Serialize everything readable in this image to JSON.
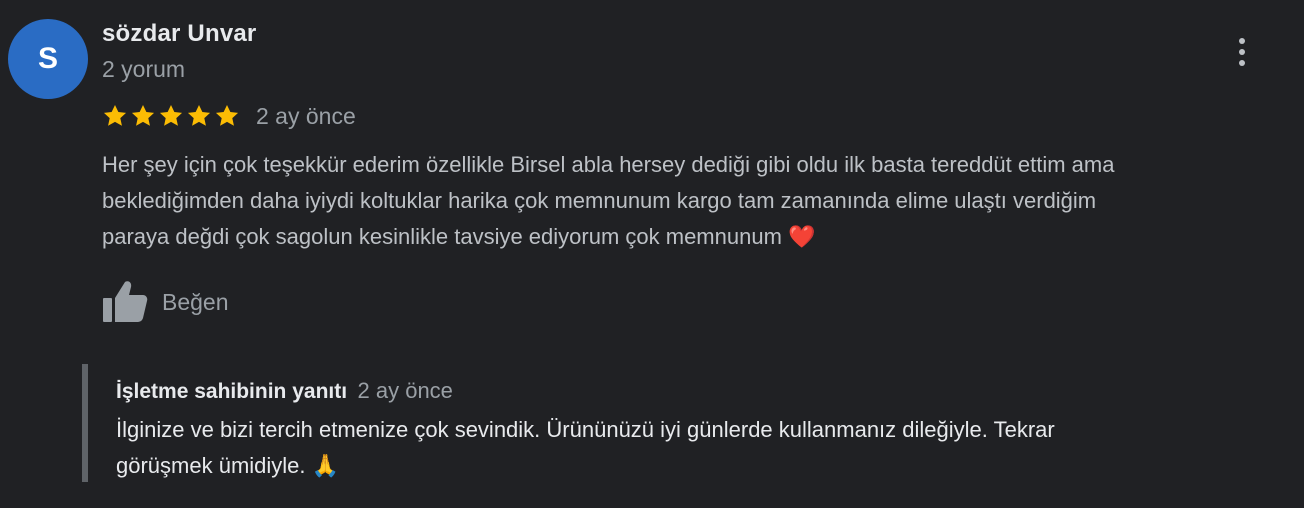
{
  "reviewer": {
    "avatar_letter": "S",
    "avatar_color": "#2a6cc4",
    "name": "sözdar Unvar",
    "review_count": "2 yorum"
  },
  "review": {
    "rating": 5,
    "max_rating": 5,
    "star_color": "#fbbc04",
    "time": "2 ay önce",
    "text_lines": [
      "Her şey için çok teşekkür ederim özellikle Birsel abla hersey dediği gibi oldu ilk basta tereddüt ettim ama",
      "beklediğimden daha iyiydi koltuklar harika çok memnunum kargo tam zamanında elime ulaştı verdiğim",
      "paraya değdi çok sagolun kesinlikle tavsiye ediyorum çok memnunum ❤️"
    ]
  },
  "actions": {
    "like_label": "Beğen",
    "like_icon": "thumbs-up-icon",
    "menu_icon": "more-vertical-icon"
  },
  "owner_reply": {
    "label": "İşletme sahibinin yanıtı",
    "time": "2 ay önce",
    "text_lines": [
      "İlginize ve bizi tercih etmenize çok sevindik. Ürününüzü iyi günlerde kullanmanız dileğiyle. Tekrar",
      "görüşmek ümidiyle. 🙏"
    ]
  }
}
